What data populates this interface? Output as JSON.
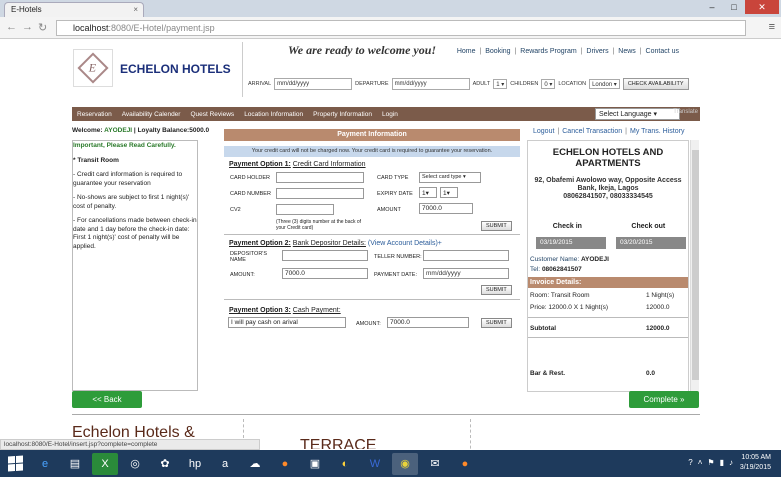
{
  "browser": {
    "tab_title": "E-Hotels",
    "url_host": "localhost",
    "url_path": ":8080/E-Hotel/payment.jsp",
    "status_url": "localhost:8080/E-Hotel/insert.jsp?complete=complete"
  },
  "header": {
    "brand": "ECHELON HOTELS",
    "tagline": "We are ready to welcome you!",
    "links": [
      "Home",
      "Booking",
      "Rewards Program",
      "Drivers",
      "News",
      "Contact us"
    ]
  },
  "search": {
    "arrival_label": "ARRIVAL",
    "arrival_placeholder": "mm/dd/yyyy",
    "departure_label": "DEPARTURE",
    "departure_placeholder": "mm/dd/yyyy",
    "adult_label": "ADULT",
    "adult_value": "1",
    "children_label": "CHILDREN",
    "children_value": "0",
    "location_label": "LOCATION",
    "location_value": "London",
    "check_button": "CHECK AVAILABILITY"
  },
  "nav": {
    "items": [
      "Reservation",
      "Availability Calender",
      "Quest Reviews",
      "Location Information",
      "Property Information",
      "Login"
    ],
    "language": "Select Language",
    "translate": "Translate"
  },
  "left": {
    "welcome_label": "Welcome:",
    "user": "AYODEJI",
    "loyalty": "Loyalty Balance:5000.0",
    "important": "Important, Please Read Carefully.",
    "room": "* Transit Room",
    "notes": [
      "- Credit card information is required to guarantee your reservation",
      "- No-shows are subject to first 1 night(s)' cost of penalty.",
      "- For cancellations made between check-in date and 1 day before the check-in date: First 1 night(s)' cost of penalty will be applied."
    ]
  },
  "payment": {
    "header": "Payment Information",
    "note": "Your credit card will not be charged now. Your credit card is required to guarantee your reservation.",
    "opt1_prefix": "Payment Option 1:",
    "opt1_title": "Credit Card Information",
    "card_holder": "CARD HOLDER",
    "card_number": "CARD NUMBER",
    "cv2": "CV2",
    "cv2_hint": "(Three (3) digits number at the back of your Credit card)",
    "card_type": "CARD TYPE",
    "card_type_value": "Select card type",
    "expiry": "EXPIRY DATE",
    "expiry_m": "1",
    "expiry_y": "1",
    "amount": "AMOUNT",
    "amount_value": "7000.0",
    "submit": "SUBMIT",
    "opt2_prefix": "Payment Option 2:",
    "opt2_title": "Bank Depositor Details:",
    "opt2_link": "(View Account Details)+",
    "depositor": "DEPOSITOR'S NAME",
    "teller": "TELLER NUMBER:",
    "amount2_label": "AMOUNT:",
    "amount2_value": "7000.0",
    "paydate_label": "PAYMENT DATE:",
    "paydate_placeholder": "mm/dd/yyyy",
    "opt3_prefix": "Payment Option 3:",
    "opt3_title": "Cash Payment:",
    "cash_value": "I will pay cash on arival",
    "amount3_label": "AMOUNT:",
    "amount3_value": "7000.0"
  },
  "right": {
    "links": [
      "Logout",
      "Cancel Transaction",
      "My Trans. History"
    ],
    "title": "ECHELON HOTELS AND APARTMENTS",
    "address": "92, Obafemi Awolowo way, Opposite Access Bank, Ikeja, Lagos",
    "phones": "08062841507, 08033334545",
    "checkin_label": "Check in",
    "checkout_label": "Check out",
    "checkin": "03/19/2015",
    "checkout": "03/20/2015",
    "customer_label": "Customer Name:",
    "customer": "AYODEJI",
    "tel_label": "Tel:",
    "tel": "08062841507",
    "invoice": "Invoice Details:",
    "room_label": "Room: Transit Room",
    "room_nights": "1 Night(s)",
    "price_label": "Price: 12000.0 X 1 Night(s)",
    "price_value": "12000.0",
    "subtotal_label": "Subtotal",
    "subtotal_value": "12000.0",
    "bar_label": "Bar & Rest.",
    "bar_value": "0.0"
  },
  "buttons": {
    "back": "<< Back",
    "complete": "Complete »"
  },
  "footer": {
    "echelon": "Echelon Hotels &",
    "terrace": "TERRACE"
  },
  "taskbar": {
    "time": "10:05 AM",
    "date": "3/19/2015"
  }
}
